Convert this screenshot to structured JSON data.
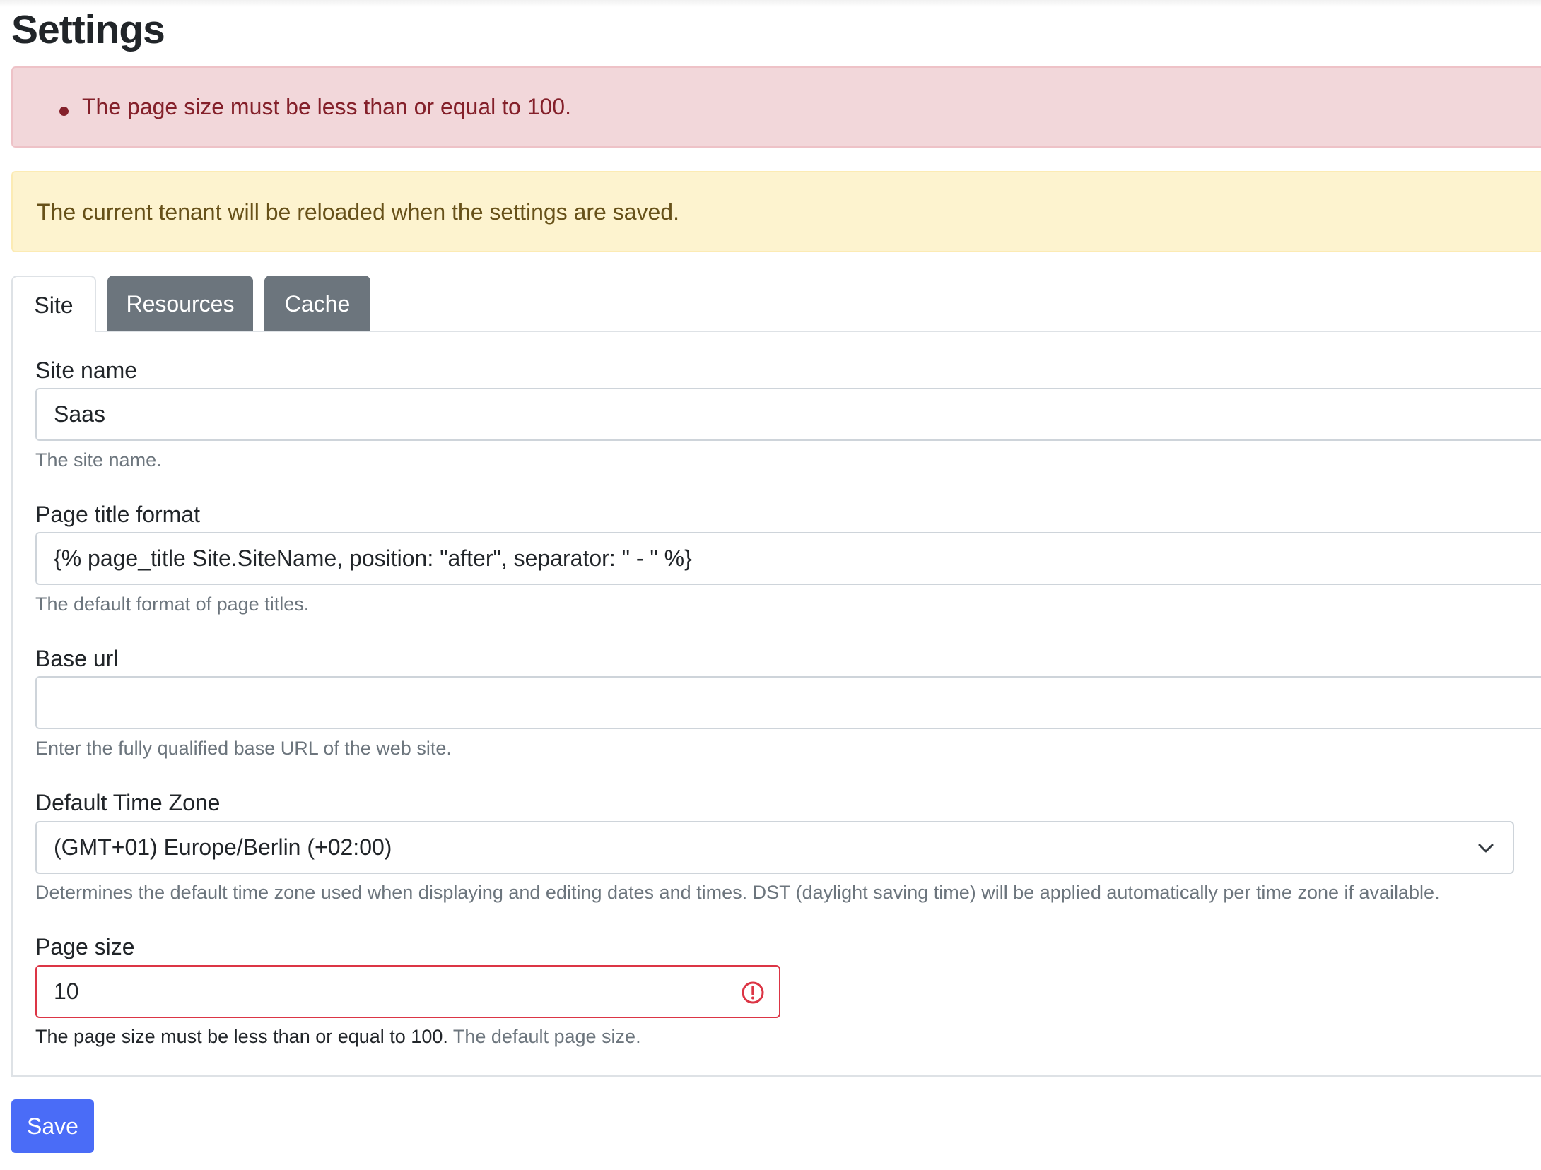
{
  "page": {
    "title": "Settings"
  },
  "alerts": {
    "errors": [
      "The page size must be less than or equal to 100."
    ],
    "warning": "The current tenant will be reloaded when the settings are saved."
  },
  "tabs": [
    {
      "label": "Site",
      "active": true
    },
    {
      "label": "Resources",
      "active": false
    },
    {
      "label": "Cache",
      "active": false
    }
  ],
  "form": {
    "site_name": {
      "label": "Site name",
      "value": "Saas",
      "help": "The site name."
    },
    "page_title_format": {
      "label": "Page title format",
      "value": "{% page_title Site.SiteName, position: \"after\", separator: \" - \" %}",
      "help": "The default format of page titles."
    },
    "base_url": {
      "label": "Base url",
      "value": "",
      "help": "Enter the fully qualified base URL of the web site."
    },
    "time_zone": {
      "label": "Default Time Zone",
      "selected": "(GMT+01) Europe/Berlin (+02:00)",
      "help": "Determines the default time zone used when displaying and editing dates and times. DST (daylight saving time) will be applied automatically per time zone if available."
    },
    "page_size": {
      "label": "Page size",
      "value": "10",
      "error": "The page size must be less than or equal to 100.",
      "help": "The default page size."
    }
  },
  "actions": {
    "save_label": "Save"
  },
  "colors": {
    "danger": "#dc3545",
    "primary": "#4a6cf7",
    "tab_inactive": "#6c757d"
  },
  "icons": {
    "error": "exclamation-circle-icon",
    "select": "chevron-down-icon"
  }
}
